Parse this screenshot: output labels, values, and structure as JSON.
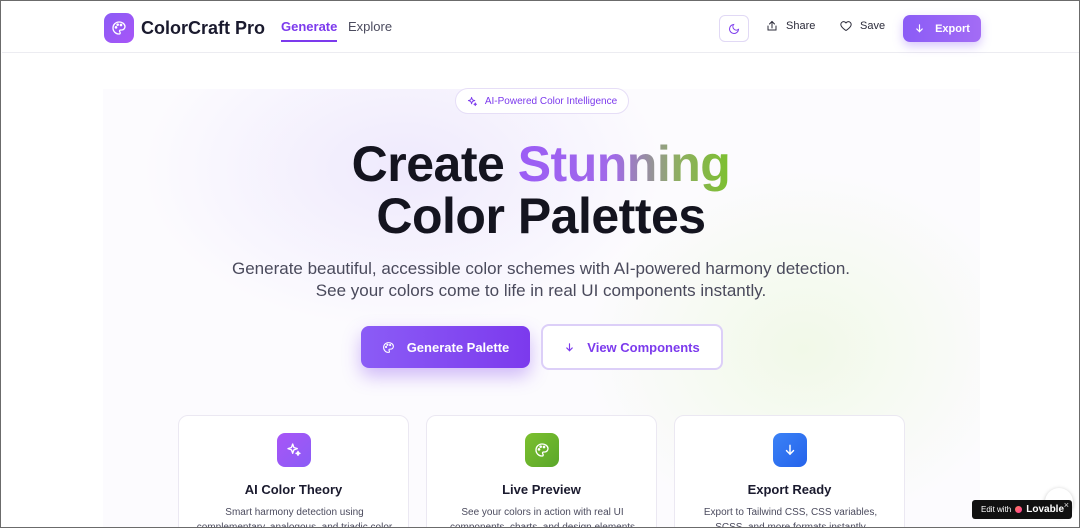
{
  "header": {
    "brand": "ColorCraft Pro",
    "nav": [
      {
        "label": "Generate",
        "active": true
      },
      {
        "label": "Explore",
        "active": false
      }
    ],
    "share_label": "Share",
    "save_label": "Save",
    "export_label": "Export"
  },
  "hero": {
    "badge": "AI-Powered Color Intelligence",
    "title_part1": "Create ",
    "title_highlight": "Stunning",
    "title_line2": "Color Palettes",
    "subtitle_line1": "Generate beautiful, accessible color schemes with AI-powered harmony detection.",
    "subtitle_line2": "See your colors come to life in real UI components instantly.",
    "primary_cta": "Generate Palette",
    "secondary_cta": "View Components"
  },
  "features": [
    {
      "title": "AI Color Theory",
      "description": "Smart harmony detection using complementary, analogous, and triadic color",
      "icon": "sparkles-icon",
      "color": "#a855f7"
    },
    {
      "title": "Live Preview",
      "description": "See your colors in action with real UI components, charts, and design elements",
      "icon": "palette-icon",
      "color": "#65b32e"
    },
    {
      "title": "Export Ready",
      "description": "Export to Tailwind CSS, CSS variables, SCSS, and more formats instantly",
      "icon": "arrow-down-icon",
      "color": "#2f6fe8"
    }
  ],
  "lovable_badge": {
    "prefix": "Edit with",
    "brand": "Lovable",
    "close": "×"
  },
  "colors": {
    "accent": "#7c3aed",
    "accent_light": "#8b5cf6",
    "green": "#7cc02f"
  }
}
